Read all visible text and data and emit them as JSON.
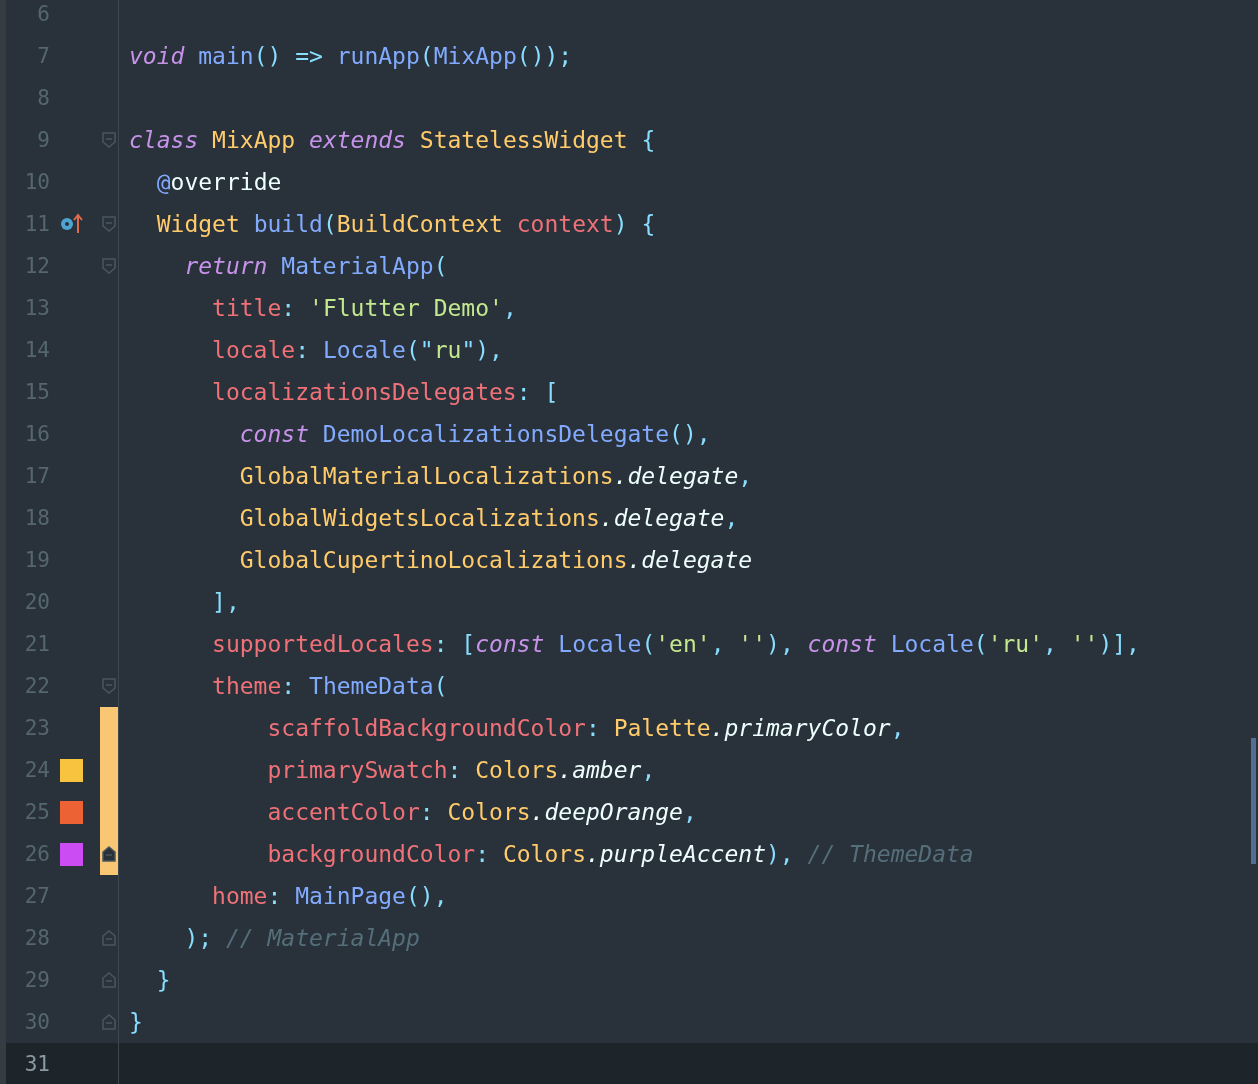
{
  "editor": {
    "lines": [
      {
        "number": "6",
        "selected": false
      },
      {
        "number": "7",
        "selected": false,
        "tokens": [
          {
            "kind": "kw",
            "text": "void"
          },
          {
            "kind": "fn",
            "text": " main"
          },
          {
            "kind": "punct",
            "text": "() => "
          },
          {
            "kind": "fn",
            "text": "runApp"
          },
          {
            "kind": "punct",
            "text": "("
          },
          {
            "kind": "fn",
            "text": "MixApp"
          },
          {
            "kind": "punct",
            "text": "());"
          }
        ]
      },
      {
        "number": "8",
        "selected": false
      },
      {
        "number": "9",
        "selected": false,
        "fold_start": true,
        "tokens": [
          {
            "kind": "kw",
            "text": "class"
          },
          {
            "kind": "type",
            "text": " MixApp "
          },
          {
            "kind": "kw",
            "text": "extends"
          },
          {
            "kind": "type",
            "text": " StatelessWidget"
          },
          {
            "kind": "punct",
            "text": " {"
          }
        ]
      },
      {
        "number": "10",
        "selected": false,
        "tokens": [
          {
            "kind": "fn",
            "text": "  @"
          },
          {
            "kind": "text",
            "text": "override"
          }
        ]
      },
      {
        "number": "11",
        "selected": false,
        "fold_start": true,
        "override": true,
        "tokens": [
          {
            "kind": "type",
            "text": "  Widget"
          },
          {
            "kind": "fn",
            "text": " build"
          },
          {
            "kind": "punct",
            "text": "("
          },
          {
            "kind": "type",
            "text": "BuildContext"
          },
          {
            "kind": "prop",
            "text": " context"
          },
          {
            "kind": "punct",
            "text": ") {"
          }
        ]
      },
      {
        "number": "12",
        "selected": false,
        "fold_start": true,
        "tokens": [
          {
            "kind": "kw",
            "text": "    return"
          },
          {
            "kind": "fn",
            "text": " MaterialApp"
          },
          {
            "kind": "punct",
            "text": "("
          }
        ]
      },
      {
        "number": "13",
        "selected": false,
        "tokens": [
          {
            "kind": "prop",
            "text": "      title"
          },
          {
            "kind": "punct",
            "text": ": "
          },
          {
            "kind": "str",
            "text": "'Flutter Demo'"
          },
          {
            "kind": "punct",
            "text": ","
          }
        ]
      },
      {
        "number": "14",
        "selected": false,
        "tokens": [
          {
            "kind": "prop",
            "text": "      locale"
          },
          {
            "kind": "punct",
            "text": ": "
          },
          {
            "kind": "fn",
            "text": "Locale"
          },
          {
            "kind": "punct",
            "text": "(\""
          },
          {
            "kind": "str",
            "text": "ru"
          },
          {
            "kind": "punct",
            "text": "\"),"
          }
        ]
      },
      {
        "number": "15",
        "selected": false,
        "tokens": [
          {
            "kind": "prop",
            "text": "      localizationsDelegates"
          },
          {
            "kind": "punct",
            "text": ": ["
          }
        ]
      },
      {
        "number": "16",
        "selected": false,
        "tokens": [
          {
            "kind": "kw",
            "text": "        const"
          },
          {
            "kind": "fn",
            "text": " DemoLocalizationsDelegate"
          },
          {
            "kind": "punct",
            "text": "(),"
          }
        ]
      },
      {
        "number": "17",
        "selected": false,
        "tokens": [
          {
            "kind": "type",
            "text": "        GlobalMaterialLocalizations"
          },
          {
            "kind": "field",
            "text": ".delegate"
          },
          {
            "kind": "punct",
            "text": ","
          }
        ]
      },
      {
        "number": "18",
        "selected": false,
        "tokens": [
          {
            "kind": "type",
            "text": "        GlobalWidgetsLocalizations"
          },
          {
            "kind": "field",
            "text": ".delegate"
          },
          {
            "kind": "punct",
            "text": ","
          }
        ]
      },
      {
        "number": "19",
        "selected": false,
        "tokens": [
          {
            "kind": "type",
            "text": "        GlobalCupertinoLocalizations"
          },
          {
            "kind": "field",
            "text": ".delegate"
          }
        ]
      },
      {
        "number": "20",
        "selected": false,
        "tokens": [
          {
            "kind": "punct",
            "text": "      ],"
          }
        ]
      },
      {
        "number": "21",
        "selected": false,
        "tokens": [
          {
            "kind": "prop",
            "text": "      supportedLocales"
          },
          {
            "kind": "punct",
            "text": ": ["
          },
          {
            "kind": "kw",
            "text": "const"
          },
          {
            "kind": "fn",
            "text": " Locale"
          },
          {
            "kind": "punct",
            "text": "("
          },
          {
            "kind": "str",
            "text": "'en'"
          },
          {
            "kind": "punct",
            "text": ", "
          },
          {
            "kind": "str",
            "text": "''"
          },
          {
            "kind": "punct",
            "text": "), "
          },
          {
            "kind": "kw",
            "text": "const"
          },
          {
            "kind": "fn",
            "text": " Locale"
          },
          {
            "kind": "punct",
            "text": "("
          },
          {
            "kind": "str",
            "text": "'ru'"
          },
          {
            "kind": "punct",
            "text": ", "
          },
          {
            "kind": "str",
            "text": "''"
          },
          {
            "kind": "punct",
            "text": ")],"
          }
        ]
      },
      {
        "number": "22",
        "selected": false,
        "fold_start": true,
        "tokens": [
          {
            "kind": "prop",
            "text": "      theme"
          },
          {
            "kind": "punct",
            "text": ": "
          },
          {
            "kind": "fn",
            "text": "ThemeData"
          },
          {
            "kind": "punct",
            "text": "("
          }
        ]
      },
      {
        "number": "23",
        "selected": false,
        "changed": true,
        "tokens": [
          {
            "kind": "prop",
            "text": "          scaffoldBackgroundColor"
          },
          {
            "kind": "punct",
            "text": ": "
          },
          {
            "kind": "type",
            "text": "Palette"
          },
          {
            "kind": "field",
            "text": ".primaryColor"
          },
          {
            "kind": "punct",
            "text": ","
          }
        ]
      },
      {
        "number": "24",
        "selected": false,
        "changed": true,
        "color": "#f8c440",
        "tokens": [
          {
            "kind": "prop",
            "text": "          primarySwatch"
          },
          {
            "kind": "punct",
            "text": ": "
          },
          {
            "kind": "type",
            "text": "Colors"
          },
          {
            "kind": "field",
            "text": ".amber"
          },
          {
            "kind": "punct",
            "text": ","
          }
        ]
      },
      {
        "number": "25",
        "selected": false,
        "changed": true,
        "color": "#ed6235",
        "tokens": [
          {
            "kind": "prop",
            "text": "          accentColor"
          },
          {
            "kind": "punct",
            "text": ": "
          },
          {
            "kind": "type",
            "text": "Colors"
          },
          {
            "kind": "field",
            "text": ".deepOrange"
          },
          {
            "kind": "punct",
            "text": ","
          }
        ]
      },
      {
        "number": "26",
        "selected": false,
        "changed": true,
        "fold_end": true,
        "color": "#cc4cf4",
        "tokens": [
          {
            "kind": "prop",
            "text": "          backgroundColor"
          },
          {
            "kind": "punct",
            "text": ": "
          },
          {
            "kind": "type",
            "text": "Colors"
          },
          {
            "kind": "field",
            "text": ".purpleAccent"
          },
          {
            "kind": "punct",
            "text": "), "
          },
          {
            "kind": "comment",
            "text": "// ThemeData"
          }
        ]
      },
      {
        "number": "27",
        "selected": false,
        "tokens": [
          {
            "kind": "prop",
            "text": "      home"
          },
          {
            "kind": "punct",
            "text": ": "
          },
          {
            "kind": "fn",
            "text": "MainPage"
          },
          {
            "kind": "punct",
            "text": "(),"
          }
        ]
      },
      {
        "number": "28",
        "selected": false,
        "fold_end": true,
        "tokens": [
          {
            "kind": "punct",
            "text": "    ); "
          },
          {
            "kind": "comment",
            "text": "// MaterialApp"
          }
        ]
      },
      {
        "number": "29",
        "selected": false,
        "fold_end": true,
        "tokens": [
          {
            "kind": "punct",
            "text": "  }"
          }
        ]
      },
      {
        "number": "30",
        "selected": false,
        "fold_end": true,
        "tokens": [
          {
            "kind": "punct",
            "text": "}"
          }
        ]
      },
      {
        "number": "31",
        "selected": true
      }
    ]
  }
}
